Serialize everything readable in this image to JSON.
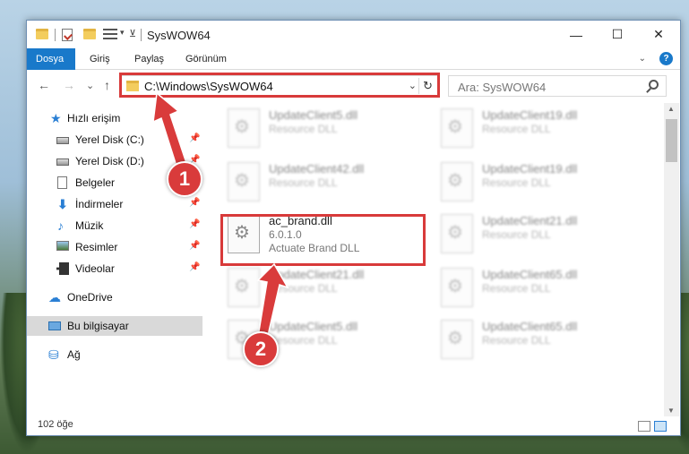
{
  "window": {
    "title": "SysWOW64",
    "min_glyph": "—",
    "max_glyph": "☐",
    "close_glyph": "✕"
  },
  "ribbon": {
    "tabs": [
      "Dosya",
      "Giriş",
      "Paylaş",
      "Görünüm"
    ],
    "active_tab": "Dosya",
    "help": "?"
  },
  "nav": {
    "back": "←",
    "forward": "→",
    "recent": "⌄",
    "up": "↑"
  },
  "address": {
    "path": "C:\\Windows\\SysWOW64",
    "dropdown": "⌄",
    "refresh": "↻"
  },
  "search": {
    "placeholder": "Ara: SysWOW64"
  },
  "sidebar": {
    "items": [
      {
        "label": "Hızlı erişim",
        "icon": "quick-access-star-icon",
        "pinned": false
      },
      {
        "label": "Yerel Disk (C:)",
        "icon": "disk-icon",
        "pinned": true
      },
      {
        "label": "Yerel Disk (D:)",
        "icon": "disk-icon",
        "pinned": true
      },
      {
        "label": "Belgeler",
        "icon": "documents-icon",
        "pinned": true
      },
      {
        "label": "İndirmeler",
        "icon": "downloads-icon",
        "pinned": true
      },
      {
        "label": "Müzik",
        "icon": "music-icon",
        "pinned": true
      },
      {
        "label": "Resimler",
        "icon": "pictures-icon",
        "pinned": true
      },
      {
        "label": "Videolar",
        "icon": "videos-icon",
        "pinned": true
      },
      {
        "label": "OneDrive",
        "icon": "onedrive-cloud-icon",
        "pinned": false
      },
      {
        "label": "Bu bilgisayar",
        "icon": "this-pc-icon",
        "pinned": false,
        "selected": true
      },
      {
        "label": "Ağ",
        "icon": "network-icon",
        "pinned": false
      }
    ],
    "pin_glyph": "📌"
  },
  "files": {
    "left": [
      {
        "name": "UpdateClient5.dll",
        "line2": "Resource DLL",
        "line3": ""
      },
      {
        "name": "UpdateClient42.dll",
        "line2": "Resource DLL",
        "line3": ""
      },
      {
        "name": "ac_brand.dll",
        "line2": "6.0.1.0",
        "line3": "Actuate Brand DLL",
        "highlighted": true
      },
      {
        "name": "UpdateClient21.dll",
        "line2": "Resource DLL",
        "line3": ""
      },
      {
        "name": "UpdateClient5.dll",
        "line2": "Resource DLL",
        "line3": ""
      }
    ],
    "right": [
      {
        "name": "UpdateClient19.dll",
        "line2": "Resource DLL",
        "line3": ""
      },
      {
        "name": "UpdateClient19.dll",
        "line2": "Resource DLL",
        "line3": ""
      },
      {
        "name": "UpdateClient21.dll",
        "line2": "Resource DLL",
        "line3": ""
      },
      {
        "name": "UpdateClient65.dll",
        "line2": "Resource DLL",
        "line3": ""
      },
      {
        "name": "UpdateClient65.dll",
        "line2": "Resource DLL",
        "line3": ""
      }
    ]
  },
  "status": {
    "item_count": "102 öğe"
  },
  "callouts": {
    "one": "1",
    "two": "2"
  },
  "colors": {
    "accent": "#1979ca",
    "highlight_red": "#d83a3a"
  }
}
